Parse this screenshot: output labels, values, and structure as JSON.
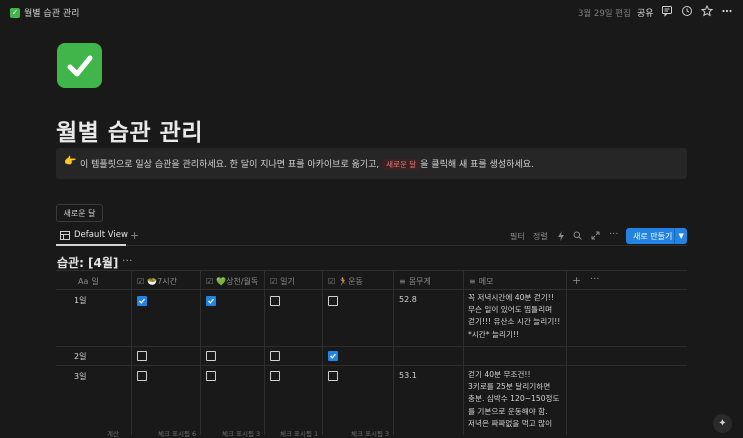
{
  "topbar": {
    "breadcrumb": "월별 습관 관리",
    "edited": "3월 29일 편집",
    "share": "공유"
  },
  "page": {
    "title": "월별 습관 관리",
    "callout_prefix": "이 템플릿으로 일상 습관을 관리하세요. 한 달이 지나면 표를 아카이브로 옮기고,",
    "callout_tag": "새로운 달",
    "callout_suffix": "을 클릭해 새 표를 생성하세요.",
    "new_month_button": "새로운 달"
  },
  "view": {
    "tab": "Default View",
    "filter": "필터",
    "sort": "정렬",
    "new_button": "새로 만들기"
  },
  "database": {
    "title": "습관: [4월]",
    "columns": [
      {
        "icon": "Aa",
        "label": "일"
      },
      {
        "icon": "☑",
        "label": "🥗7시간"
      },
      {
        "icon": "☑",
        "label": "💚상천/월독"
      },
      {
        "icon": "☑",
        "label": "일기"
      },
      {
        "icon": "☑",
        "label": "🏃운동"
      },
      {
        "icon": "≡",
        "label": "몸무게"
      },
      {
        "icon": "≡",
        "label": "메모"
      }
    ],
    "rows": [
      {
        "day": "1일",
        "c1": true,
        "c2": true,
        "c3": false,
        "c4": false,
        "weight": "52.8",
        "memo": [
          "꼭 저녁시간에 40분 걷기!!",
          "무슨 일이 있어도 띰틀리며",
          "걷기!!! 유산소 시간 늘리기!!",
          "*시간* 늘리기!!"
        ]
      },
      {
        "day": "2일",
        "c1": false,
        "c2": false,
        "c3": false,
        "c4": true,
        "weight": "",
        "memo": []
      },
      {
        "day": "3일",
        "c1": false,
        "c2": false,
        "c3": false,
        "c4": false,
        "weight": "53.1",
        "memo": [
          "걷기 40분 무조건!!",
          "3키로를 25분 달리기하면",
          "충분. 심박수 120~150정도",
          "를 기본으로 운동해야 함.",
          "저녁은 짜짜없을 먹고 많이"
        ]
      }
    ],
    "calc_row": [
      {
        "label": "계산",
        "value": ""
      },
      {
        "label": "체크 표시됨",
        "value": "6"
      },
      {
        "label": "체크 표시됨",
        "value": "3"
      },
      {
        "label": "체크 표시됨",
        "value": "1"
      },
      {
        "label": "체크 표시됨",
        "value": "3"
      }
    ]
  }
}
